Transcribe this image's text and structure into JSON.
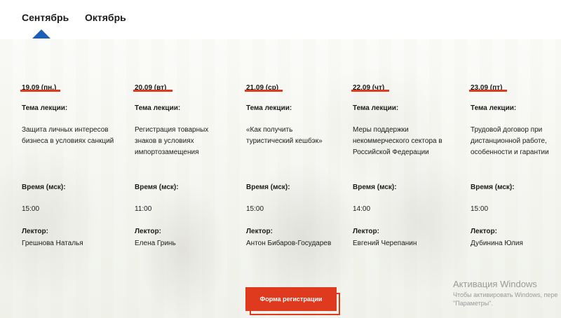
{
  "tabs": {
    "september": "Сентябрь",
    "october": "Октябрь",
    "active": "september"
  },
  "accent_color": "#e03a1e",
  "pointer_color": "#1d5fb8",
  "labels": {
    "topic": "Тема лекции:",
    "time": "Время (мск):",
    "lecturer": "Лектор:"
  },
  "lectures": [
    {
      "date": "19.09 (пн.)",
      "topic": "Защита личных интересов бизнеса в условиях санкций",
      "time": "15:00",
      "lecturer": "Грешнова Наталья"
    },
    {
      "date": "20.09 (вт)",
      "topic": "Регистрация товарных знаков в условиях импортозамещения",
      "time": "11:00",
      "lecturer": "Елена Гринь"
    },
    {
      "date": "21.09 (ср)",
      "topic": "«Как получить туристический кешбэк»",
      "time": "15:00",
      "lecturer": "Антон Бибаров-Государев"
    },
    {
      "date": "22.09 (чт)",
      "topic": "Меры поддержки некоммерческого сектора в Российской Федерации",
      "time": "14:00",
      "lecturer": "Евгений Черепанин"
    },
    {
      "date": "23.09 (пт)",
      "topic": "Трудовой договор при дистанционной работе, особенности и гарантии",
      "time": "15:00",
      "lecturer": "Дубинина Юлия"
    }
  ],
  "register_button": "Форма регистрации",
  "windows_watermark": {
    "title": "Активация Windows",
    "subtitle": "Чтобы активировать Windows, пере\n\"Параметры\"."
  }
}
